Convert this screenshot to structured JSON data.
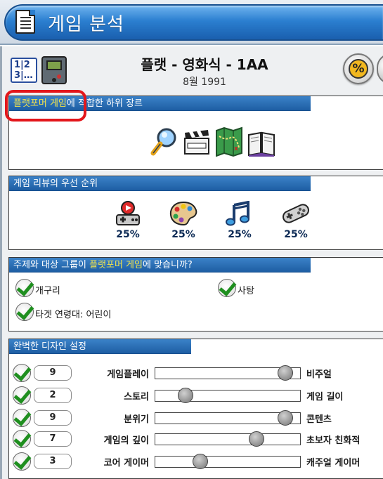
{
  "window": {
    "title": "게임 분석"
  },
  "game": {
    "title": "플랫 - 영화식 - 1AA",
    "date": "8월 1991"
  },
  "header_buttons": {
    "percent_label": "%"
  },
  "sections": {
    "genre": {
      "title_highlight": "플랫포머 게임",
      "title_rest": "에 적합한 하위 장르",
      "icons": [
        "magnifier-icon",
        "clapperboard-icon",
        "map-icon",
        "book-icon"
      ]
    },
    "review": {
      "title": "게임 리뷰의 우선 순위",
      "items": [
        {
          "icon": "gamepad-play-icon",
          "value": "25%"
        },
        {
          "icon": "palette-icon",
          "value": "25%"
        },
        {
          "icon": "music-icon",
          "value": "25%"
        },
        {
          "icon": "controller-icon",
          "value": "25%"
        }
      ]
    },
    "topic": {
      "title_start": "주제와 대상 그룹이 ",
      "title_highlight": "플랫포머 게임",
      "title_end": "에 맞습니까?",
      "topic_value": "개구리",
      "target_value": "타겟 연령대: 어린이",
      "extra_value": "사탕"
    },
    "design": {
      "title": "완벽한 디자인 설정",
      "rows": [
        {
          "value": "9",
          "left_label": "게임플레이",
          "right_label": "비주얼",
          "level": 0.9
        },
        {
          "value": "2",
          "left_label": "스토리",
          "right_label": "게임 길이",
          "level": 0.21
        },
        {
          "value": "9",
          "left_label": "분위기",
          "right_label": "콘텐츠",
          "level": 0.9
        },
        {
          "value": "7",
          "left_label": "게임의 깊이",
          "right_label": "초보자 친화적",
          "level": 0.7
        },
        {
          "value": "3",
          "left_label": "코어 게이머",
          "right_label": "캐주얼 게이머",
          "level": 0.31
        }
      ]
    }
  }
}
